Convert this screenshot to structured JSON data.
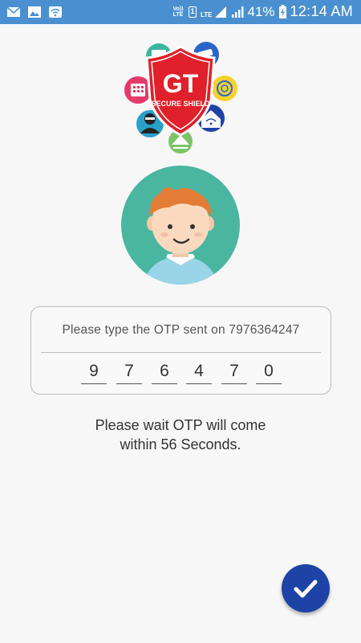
{
  "status_bar": {
    "volte": "Vo)) LTE",
    "sim_slot": "1",
    "network": "LTE",
    "battery": "41%",
    "time": "12:14 AM"
  },
  "logo": {
    "brand": "GT",
    "tagline": "SECURE SHIELD"
  },
  "otp": {
    "prompt": "Please type the OTP sent on 7976364247",
    "digits": [
      "9",
      "7",
      "6",
      "4",
      "7",
      "0"
    ]
  },
  "wait": {
    "line1": "Please wait OTP will come",
    "line2": "within 56 Seconds."
  },
  "colors": {
    "status_bar": "#4a90d0",
    "avatar_bg": "#4ab6a0",
    "shield_red": "#e0202a",
    "fab": "#1e43a6"
  },
  "icons": {
    "submit": "check-icon"
  }
}
